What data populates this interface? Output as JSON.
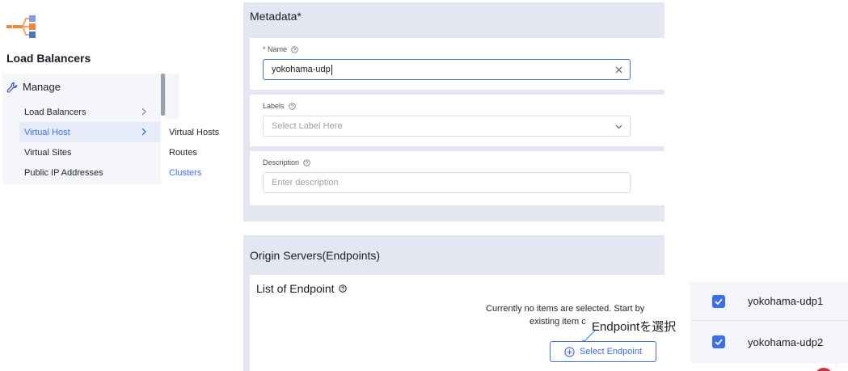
{
  "app": {
    "title": "Load Balancers"
  },
  "nav": {
    "section": "Manage",
    "items": [
      {
        "label": "Load Balancers",
        "has_chevron": true
      },
      {
        "label": "Virtual Host",
        "has_chevron": true,
        "active": true
      },
      {
        "label": "Virtual Sites"
      },
      {
        "label": "Public IP Addresses"
      }
    ],
    "submenu": [
      {
        "label": "Virtual Hosts"
      },
      {
        "label": "Routes"
      },
      {
        "label": "Clusters",
        "active": true
      }
    ]
  },
  "metadata": {
    "title": "Metadata*",
    "name_label": "* Name",
    "name_value": "yokohama-udp",
    "labels_label": "Labels",
    "labels_placeholder": "Select Label Here",
    "description_label": "Description",
    "description_placeholder": "Enter description"
  },
  "origin": {
    "title": "Origin Servers(Endpoints)",
    "list_title": "List of Endpoint",
    "empty_line1": "Currently no items are selected. Start by",
    "empty_line2": "existing item c",
    "select_button": "Select Endpoint"
  },
  "annotation": "Endpointを選択",
  "selection": {
    "items": [
      {
        "label": "yokohama-udp1",
        "checked": true
      },
      {
        "label": "yokohama-udp2",
        "checked": true
      }
    ]
  },
  "colors": {
    "accent": "#3d6df2",
    "panel": "#e4e7f1",
    "nav_bg": "#f5f6f9",
    "logo_orange": "#f5863c",
    "logo_blue": "#4a78c8",
    "danger": "#d42a3a"
  },
  "icons": {
    "logo": "load-balancer-logo",
    "manage": "wrench-icon",
    "help": "question-circle-icon",
    "clear": "close-icon",
    "dropdown": "chevron-down-icon",
    "add": "plus-circle-icon",
    "check": "check-icon"
  }
}
